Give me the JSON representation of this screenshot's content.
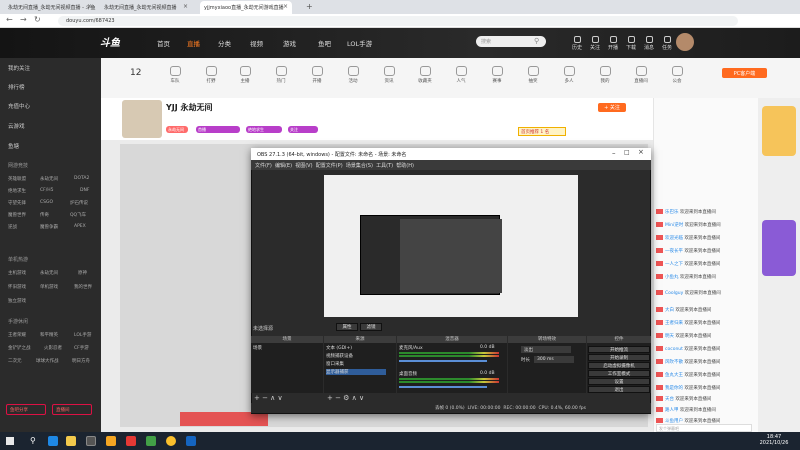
{
  "browser": {
    "tabs": [
      "永劫无间直播_永劫无间视频直播 - 斗鱼",
      "永劫无间直播_永劫无间视频直播",
      "yjjmyxiaoo直播_永劫无间游戏直播"
    ],
    "url": "douyu.com/687423"
  },
  "header": {
    "logo": "斗鱼",
    "nav": [
      "首页",
      "直播",
      "分类",
      "视频",
      "游戏",
      "鱼吧",
      "LOL手游"
    ],
    "active_nav": "直播",
    "search_placeholder": "搜索",
    "icons": [
      "历史",
      "关注",
      "开播",
      "下载",
      "消息",
      "任务"
    ]
  },
  "sidebar": {
    "items": [
      "我的关注",
      "排行榜",
      "充值中心",
      "云游戏",
      "鱼塘"
    ],
    "section1": "网游竞技",
    "games1": [
      "英雄联盟",
      "永劫无间",
      "DOTA2",
      "绝地求生",
      "CF/H5",
      "DNF",
      "守望先锋",
      "CSGO",
      "炉石传说",
      "魔兽世界",
      "传奇",
      "QQ飞车",
      "逆战",
      "魔兽争霸",
      "APEX"
    ],
    "section2": "单机热游",
    "games2": [
      "主机游戏",
      "永劫无间",
      "原神",
      "怀旧游戏",
      "单机游戏",
      "我的世界",
      "独立游戏"
    ],
    "section3": "手游休闲",
    "games3": [
      "王者荣耀",
      "和平精英",
      "LOL手游",
      "金铲铲之战",
      "火影忍者",
      "CF手游",
      "二次元",
      "球球大作战",
      "明日方舟"
    ],
    "buttons": [
      "鱼吧分享",
      "直播间"
    ]
  },
  "categories": [
    "全部分类",
    "车队",
    "打野",
    "主播",
    "热门",
    "开播",
    "活动",
    "资讯",
    "收藏夹",
    "人气",
    "赛事",
    "抽奖",
    "多人",
    "我的",
    "直播间",
    "公会",
    "宝藏",
    "天际",
    "收起"
  ],
  "room": {
    "title": "YJJ 永劫无间",
    "watchers": "12",
    "tags": [
      "永劫无间",
      "首播",
      "绝地求生",
      "关注"
    ],
    "follow": "+ 关注",
    "rank_badge": "首页推荐 1 名"
  },
  "obs": {
    "title": "OBS 27.1.3 (64-bit, windows) - 配置文件: 未命名 - 场景: 未命名",
    "menu": [
      "文件(F)",
      "编辑(E)",
      "视图(V)",
      "配置文件(P)",
      "场景集合(S)",
      "工具(T)",
      "帮助(H)"
    ],
    "no_source": "未选择源",
    "prop_buttons": [
      "属性",
      "滤镜"
    ],
    "docks": [
      "场景",
      "来源",
      "混音器",
      "转场特效",
      "控件"
    ],
    "scene": "场景",
    "sources": [
      "文本 (GDI+)",
      "视频捕获设备",
      "窗口采集",
      "显示器捕获"
    ],
    "mixer": [
      {
        "name": "麦克风/Aux",
        "db": "0.0 dB"
      },
      {
        "name": "桌面音频",
        "db": "0.0 dB"
      }
    ],
    "transition": "淡出",
    "duration_label": "时长",
    "duration": "300 ms",
    "controls": [
      "开始推流",
      "开始录制",
      "启动虚拟摄像机",
      "工作室模式",
      "设置",
      "退出"
    ],
    "status": {
      "drop": "丢帧 0 (0.0%)",
      "live": "LIVE: 00:00:00",
      "rec": "REC: 00:00:00",
      "cpu": "CPU: 0.4%, 60.00 fps"
    }
  },
  "chat": {
    "lines": [
      {
        "name": "乐巴乐",
        "text": "欢迎来到本直播间"
      },
      {
        "name": "Mini逆时",
        "text": "欢迎来到本直播间"
      },
      {
        "name": "欢迎光临",
        "text": "欢迎来到本直播间"
      },
      {
        "name": "一夜长平",
        "text": "欢迎来到本直播间"
      },
      {
        "name": "一人之下",
        "text": "欢迎来到本直播间"
      },
      {
        "name": "小鱼丸",
        "text": "欢迎来到本直播间"
      },
      {
        "name": "Coolguy",
        "text": "欢迎来到本直播间"
      },
      {
        "name": "大白",
        "text": "欢迎来到本直播间"
      },
      {
        "name": "王者归来",
        "text": "欢迎来到本直播间"
      },
      {
        "name": "明天",
        "text": "欢迎来到本直播间"
      },
      {
        "name": "coconut",
        "text": "欢迎来到本直播间"
      },
      {
        "name": "风吹不散",
        "text": "欢迎来到本直播间"
      },
      {
        "name": "鱼丸大王",
        "text": "欢迎来到本直播间"
      },
      {
        "name": "我是你的",
        "text": "欢迎来到本直播间"
      },
      {
        "name": "天台",
        "text": "欢迎来到本直播间"
      },
      {
        "name": "路人甲",
        "text": "欢迎来到本直播间"
      },
      {
        "name": "斗鱼用户",
        "text": "欢迎来到本直播间"
      }
    ],
    "input_placeholder": "发个弹幕吧",
    "send": "发送"
  },
  "taskbar": {
    "time": "18:47",
    "date": "2021/10/26"
  }
}
